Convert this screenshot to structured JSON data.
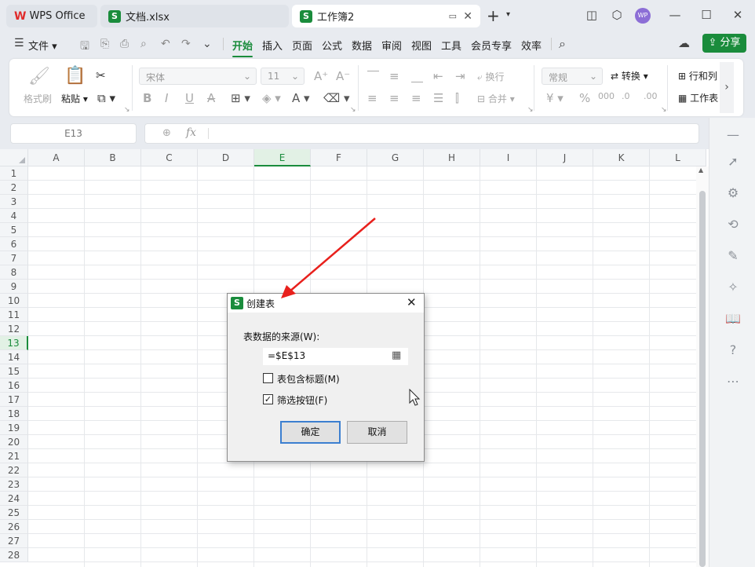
{
  "titlebar": {
    "tabs": [
      {
        "label": "WPS Office",
        "icon": "wps-logo-icon"
      },
      {
        "label": "文档.xlsx",
        "icon": "spreadsheet-icon"
      },
      {
        "label": "工作簿2",
        "icon": "spreadsheet-icon"
      }
    ],
    "new_tab": "+",
    "avatar": "WP"
  },
  "menubar": {
    "file": "文件",
    "items": [
      "开始",
      "插入",
      "页面",
      "公式",
      "数据",
      "审阅",
      "视图",
      "工具",
      "会员专享",
      "效率"
    ],
    "share": "分享"
  },
  "ribbon": {
    "format_painter": "格式刷",
    "paste": "粘贴",
    "font_name": "宋体",
    "font_size": "11",
    "wrap": "换行",
    "merge": "合并",
    "number_format": "常规",
    "convert": "转换",
    "rows_cols": "行和列",
    "worksheet": "工作表"
  },
  "formula_bar": {
    "name_box": "E13",
    "fx": "fx"
  },
  "sheet": {
    "columns": [
      "A",
      "B",
      "C",
      "D",
      "E",
      "F",
      "G",
      "H",
      "I",
      "J",
      "K",
      "L"
    ],
    "selected_column": "E",
    "rows": [
      "1",
      "2",
      "3",
      "4",
      "5",
      "6",
      "7",
      "8",
      "9",
      "10",
      "11",
      "12",
      "13",
      "14",
      "15",
      "16",
      "17",
      "18",
      "19",
      "20",
      "21",
      "22",
      "23",
      "24",
      "25",
      "26",
      "27",
      "28"
    ],
    "selected_row": "13"
  },
  "dialog": {
    "title": "创建表",
    "source_label": "表数据的来源(W):",
    "source_value": "=$E$13",
    "has_headers_label": "表包含标题(M)",
    "has_headers_checked": false,
    "filter_label": "筛选按钮(F)",
    "filter_checked": true,
    "ok": "确定",
    "cancel": "取消"
  },
  "colors": {
    "accent": "#1a8c3c",
    "annotation_arrow": "#e8201c",
    "dialog_focus": "#3c7fd0"
  }
}
